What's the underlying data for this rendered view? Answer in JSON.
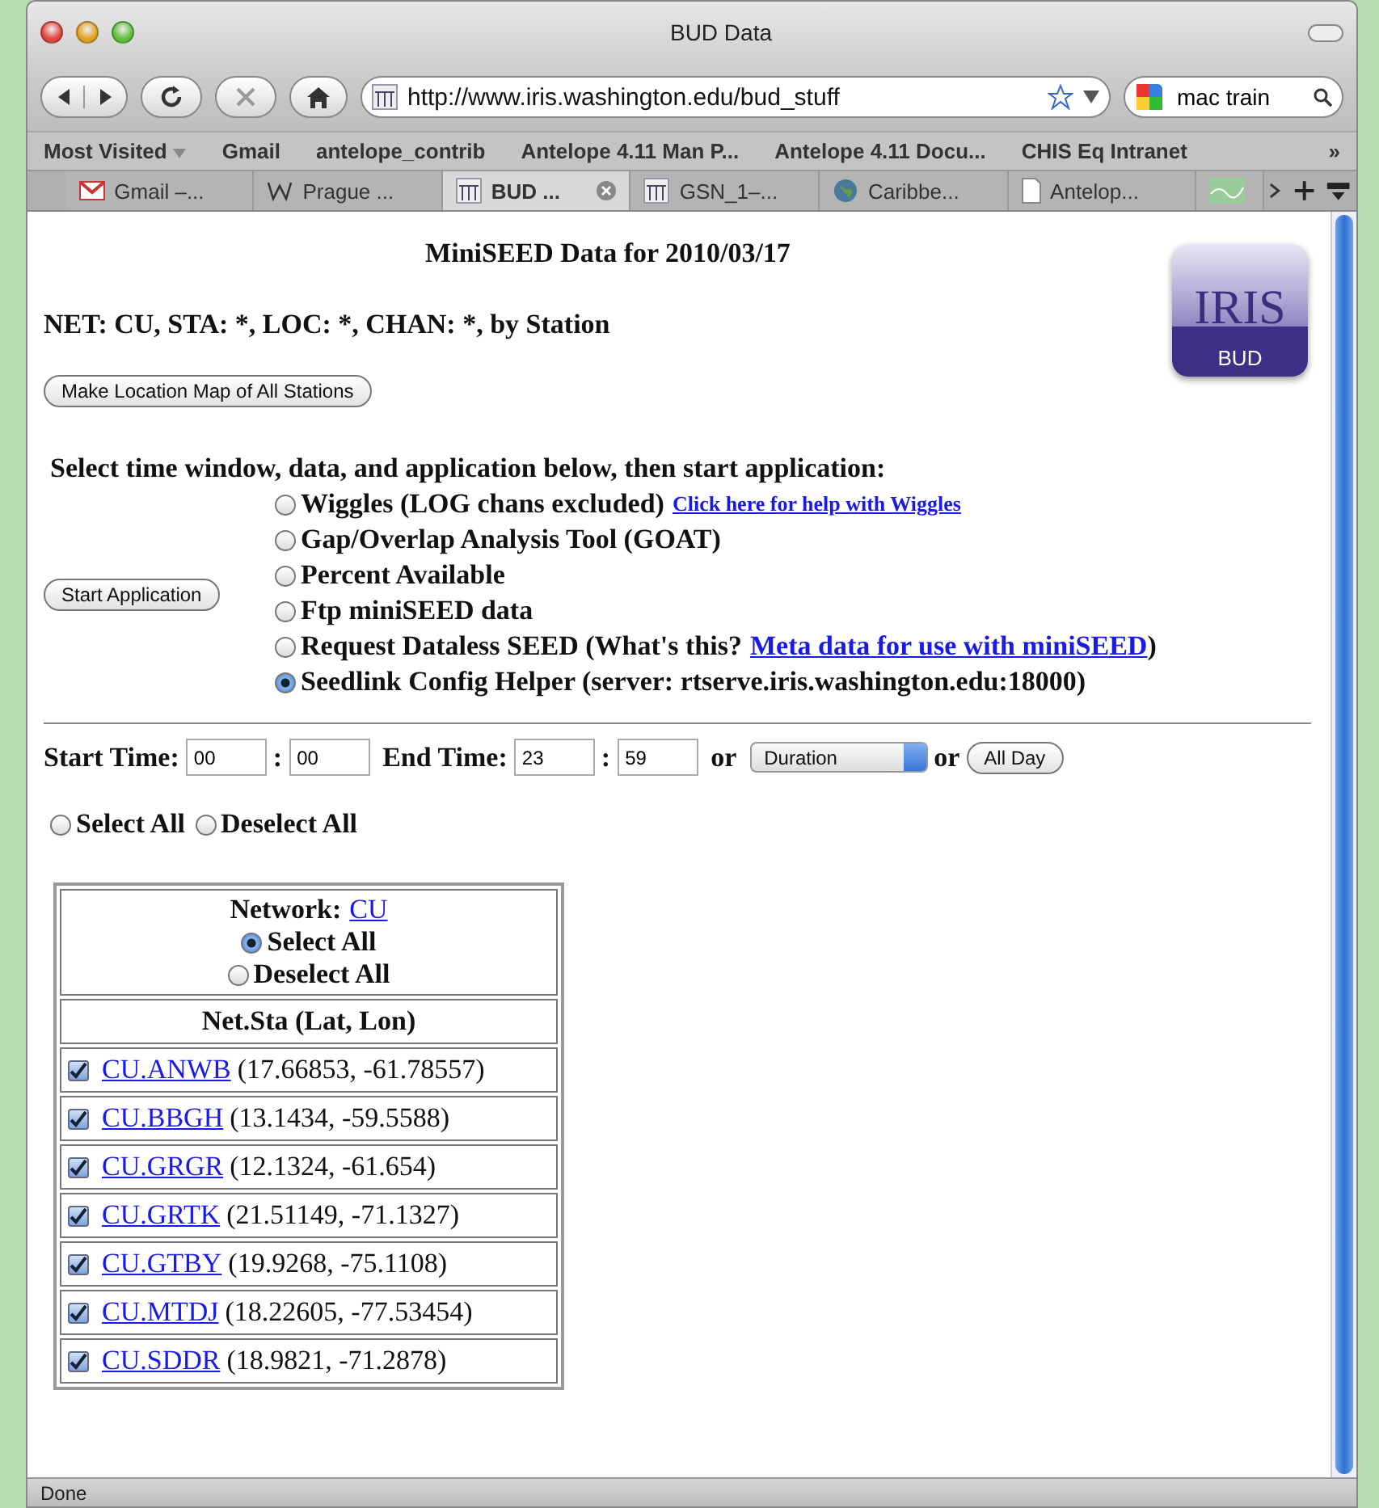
{
  "window": {
    "title": "BUD Data"
  },
  "toolbar": {
    "url": "http://www.iris.washington.edu/bud_stuff",
    "search": "mac train"
  },
  "bookmarks": [
    {
      "label": "Most Visited",
      "menu": true
    },
    {
      "label": "Gmail",
      "menu": false
    },
    {
      "label": "antelope_contrib",
      "menu": false
    },
    {
      "label": "Antelope 4.11 Man P...",
      "menu": false
    },
    {
      "label": "Antelope 4.11  Docu...",
      "menu": false
    },
    {
      "label": "CHIS Eq Intranet",
      "menu": false
    }
  ],
  "bookmarks_more": "»",
  "tabs": [
    {
      "label": "Gmail –...",
      "kind": "mail",
      "selected": false
    },
    {
      "label": "Prague ...",
      "kind": "wiki",
      "selected": false
    },
    {
      "label": "BUD ...",
      "kind": "iris",
      "selected": true
    },
    {
      "label": "GSN_1–...",
      "kind": "iris",
      "selected": false
    },
    {
      "label": "Caribbe...",
      "kind": "globe",
      "selected": false
    },
    {
      "label": "Antelop...",
      "kind": "doc",
      "selected": false
    },
    {
      "kind": "wave",
      "selected": false
    }
  ],
  "page": {
    "heading": "MiniSEED Data for 2010/03/17",
    "subheading": "NET: CU, STA: *, LOC: *, CHAN: *, by Station",
    "logo": {
      "title": "IRIS",
      "band": "BUD"
    },
    "map_button": "Make Location Map of All Stations",
    "instructions": "Select time window, data, and application below, then start application:",
    "start_button": "Start Application",
    "applications": [
      {
        "label": "Wiggles (LOG chans excluded)",
        "help_link": "Click here for help with Wiggles",
        "selected": false
      },
      {
        "label": "Gap/Overlap Analysis Tool (GOAT)",
        "selected": false
      },
      {
        "label": "Percent Available",
        "selected": false
      },
      {
        "label": "Ftp miniSEED data",
        "selected": false
      },
      {
        "label": "Request Dataless SEED (What's this?",
        "link": "Meta data for use with miniSEED",
        "suffix": ")",
        "selected": false
      },
      {
        "label": "Seedlink Config Helper (server: rtserve.iris.washington.edu:18000)",
        "selected": true
      }
    ],
    "time": {
      "start_label": "Start Time:",
      "start_hour": "00",
      "start_minute": "00",
      "end_label": "End Time:",
      "end_hour": "23",
      "end_minute": "59",
      "separator": ":",
      "or_1": "or",
      "duration": "Duration",
      "or_2": "or",
      "all_day": "All Day"
    },
    "global_select": [
      {
        "label": "Select All",
        "selected": false
      },
      {
        "label": "Deselect All",
        "selected": false
      }
    ],
    "network": {
      "label": "Network:",
      "code": "CU",
      "select": [
        {
          "label": "Select All",
          "selected": true
        },
        {
          "label": "Deselect All",
          "selected": false
        }
      ],
      "column": "Net.Sta (Lat, Lon)",
      "stations": [
        {
          "code": "CU.ANWB",
          "coords": "(17.66853, -61.78557)",
          "checked": true
        },
        {
          "code": "CU.BBGH",
          "coords": "(13.1434, -59.5588)",
          "checked": true
        },
        {
          "code": "CU.GRGR",
          "coords": "(12.1324, -61.654)",
          "checked": true
        },
        {
          "code": "CU.GRTK",
          "coords": "(21.51149, -71.1327)",
          "checked": true
        },
        {
          "code": "CU.GTBY",
          "coords": "(19.9268, -75.1108)",
          "checked": true
        },
        {
          "code": "CU.MTDJ",
          "coords": "(18.22605, -77.53454)",
          "checked": true
        },
        {
          "code": "CU.SDDR",
          "coords": "(18.9821, -71.2878)",
          "checked": true
        }
      ]
    }
  },
  "status_bar": {
    "text": "Done"
  }
}
